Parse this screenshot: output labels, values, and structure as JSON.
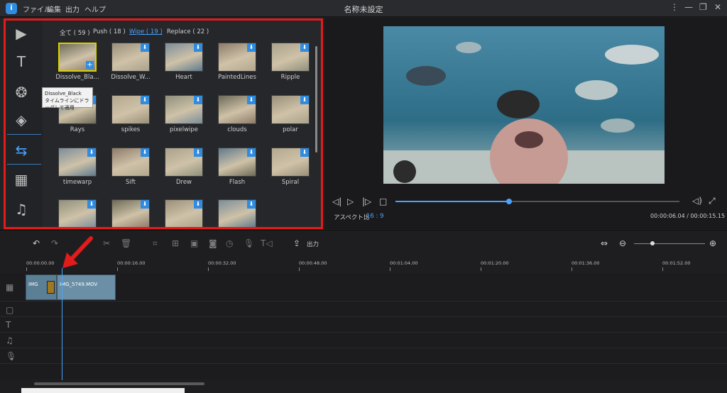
{
  "app": {
    "logo_glyph": "i",
    "title": "名称未設定",
    "menu": [
      "ファイル",
      "編集",
      "出力",
      "ヘルプ"
    ]
  },
  "window_controls": [
    "more-icon",
    "minimize-icon",
    "restore-icon",
    "close-icon"
  ],
  "sidebar": {
    "items": [
      "media-icon",
      "text-icon",
      "filters-icon",
      "overlay-icon",
      "transition-icon",
      "elements-icon",
      "music-icon"
    ],
    "active": "transition-icon"
  },
  "tabs": [
    {
      "label": "全て ( 59 )"
    },
    {
      "label": "Push ( 18 )"
    },
    {
      "label": "Wipe ( 19 )"
    },
    {
      "label": "Replace ( 22 )"
    }
  ],
  "active_tab": "Wipe ( 19 )",
  "transitions": [
    {
      "label": "Dissolve_Bla..."
    },
    {
      "label": "Dissolve_W..."
    },
    {
      "label": "Heart"
    },
    {
      "label": "PaintedLines"
    },
    {
      "label": "Ripple"
    },
    {
      "label": "Rays"
    },
    {
      "label": "spikes"
    },
    {
      "label": "pixelwipe"
    },
    {
      "label": "clouds"
    },
    {
      "label": "polar"
    },
    {
      "label": "timewarp"
    },
    {
      "label": "Sift"
    },
    {
      "label": "Drew"
    },
    {
      "label": "Flash"
    },
    {
      "label": "Spiral"
    },
    {
      "label": ""
    },
    {
      "label": ""
    },
    {
      "label": ""
    },
    {
      "label": ""
    }
  ],
  "tooltip": {
    "title": "Dissolve_Black",
    "hint": "タイムラインにドラッグして適用"
  },
  "preview": {
    "aspect_label": "アスペクト比",
    "aspect_value": "16 : 9",
    "timecode": "00:00:06.04 / 00:00:15.15",
    "progress": 0.4
  },
  "toolbar": {
    "export_label": "出力"
  },
  "ruler": [
    "00:00:00.00",
    "00:00:16.00",
    "00:00:32.00",
    "00:00:48.00",
    "00:01:04.00",
    "00:01:20.00",
    "00:01:36.00",
    "00:01:52.00"
  ],
  "clips": [
    {
      "label": "IMG"
    },
    {
      "label": "IMG_5749.MOV"
    }
  ],
  "colors": {
    "accent": "#4aa3ff",
    "annotation_red": "#e21b1b",
    "selected_border": "#d8d000"
  }
}
